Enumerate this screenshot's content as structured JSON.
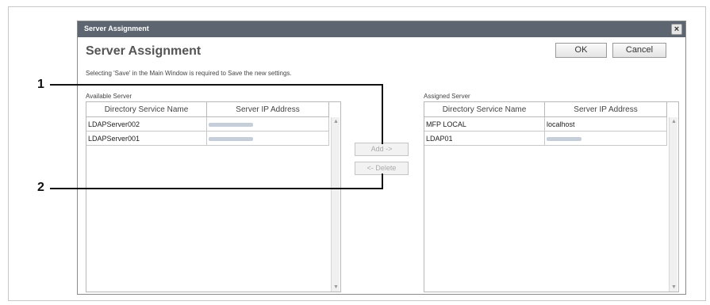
{
  "window": {
    "title": "Server Assignment",
    "close_glyph": "×"
  },
  "dialog": {
    "heading": "Server Assignment",
    "ok_label": "OK",
    "cancel_label": "Cancel",
    "note": "Selecting 'Save' in the Main Window is required to Save the new settings."
  },
  "available": {
    "label": "Available Server",
    "columns": [
      "Directory Service Name",
      "Server IP Address"
    ],
    "rows": [
      {
        "name": "LDAPServer002",
        "ip": ""
      },
      {
        "name": "LDAPServer001",
        "ip": ""
      }
    ]
  },
  "assigned": {
    "label": "Assigned Server",
    "columns": [
      "Directory Service Name",
      "Server IP Address"
    ],
    "rows": [
      {
        "name": "MFP LOCAL",
        "ip": "localhost"
      },
      {
        "name": "LDAP01",
        "ip": ""
      }
    ]
  },
  "actions": {
    "add_label": "Add ->",
    "delete_label": "<- Delete"
  },
  "callouts": [
    "1",
    "2"
  ]
}
